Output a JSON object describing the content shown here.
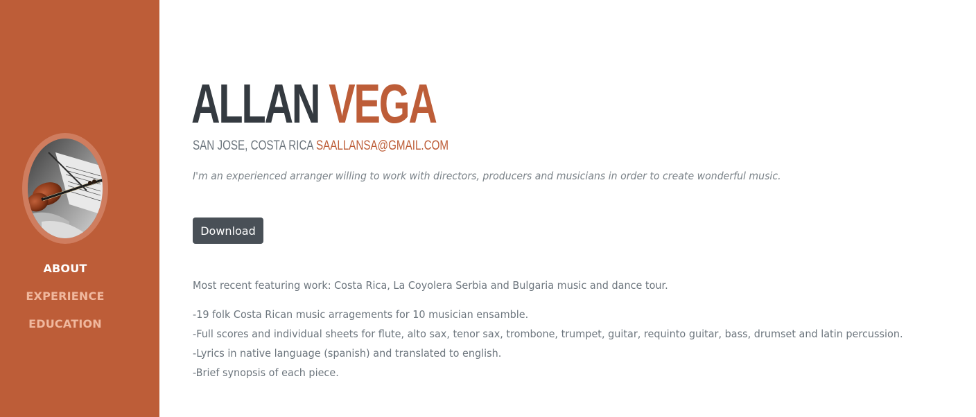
{
  "colors": {
    "primary": "#bd5d38",
    "dark": "#343a40",
    "muted": "#6c757d",
    "button": "#495057"
  },
  "sidebar": {
    "avatar_icon": "violin-photo",
    "nav": [
      {
        "label": "ABOUT",
        "active": true
      },
      {
        "label": "EXPERIENCE",
        "active": false
      },
      {
        "label": "EDUCATION",
        "active": false
      }
    ]
  },
  "about": {
    "first_name": "ALLAN",
    "last_name": "VEGA",
    "location": "SAN JOSE, COSTA RICA",
    "email": "SAALLANSA@GMAIL.COM",
    "lead": "I'm an experienced arranger willing to work with directors, producers and musicians in order to create wonderful music.",
    "download_label": "Download",
    "recent_work": "Most recent featuring work: Costa Rica, La Coyolera Serbia and Bulgaria music and dance tour.",
    "details": [
      "-19 folk Costa Rican music arragements for 10 musician ensamble.",
      "-Full scores and individual sheets for flute, alto sax, tenor sax, trombone, trumpet, guitar, requinto guitar, bass, drumset and latin percussion.",
      "-Lyrics in native language (spanish) and translated to english.",
      "-Brief synopsis of each piece."
    ]
  }
}
